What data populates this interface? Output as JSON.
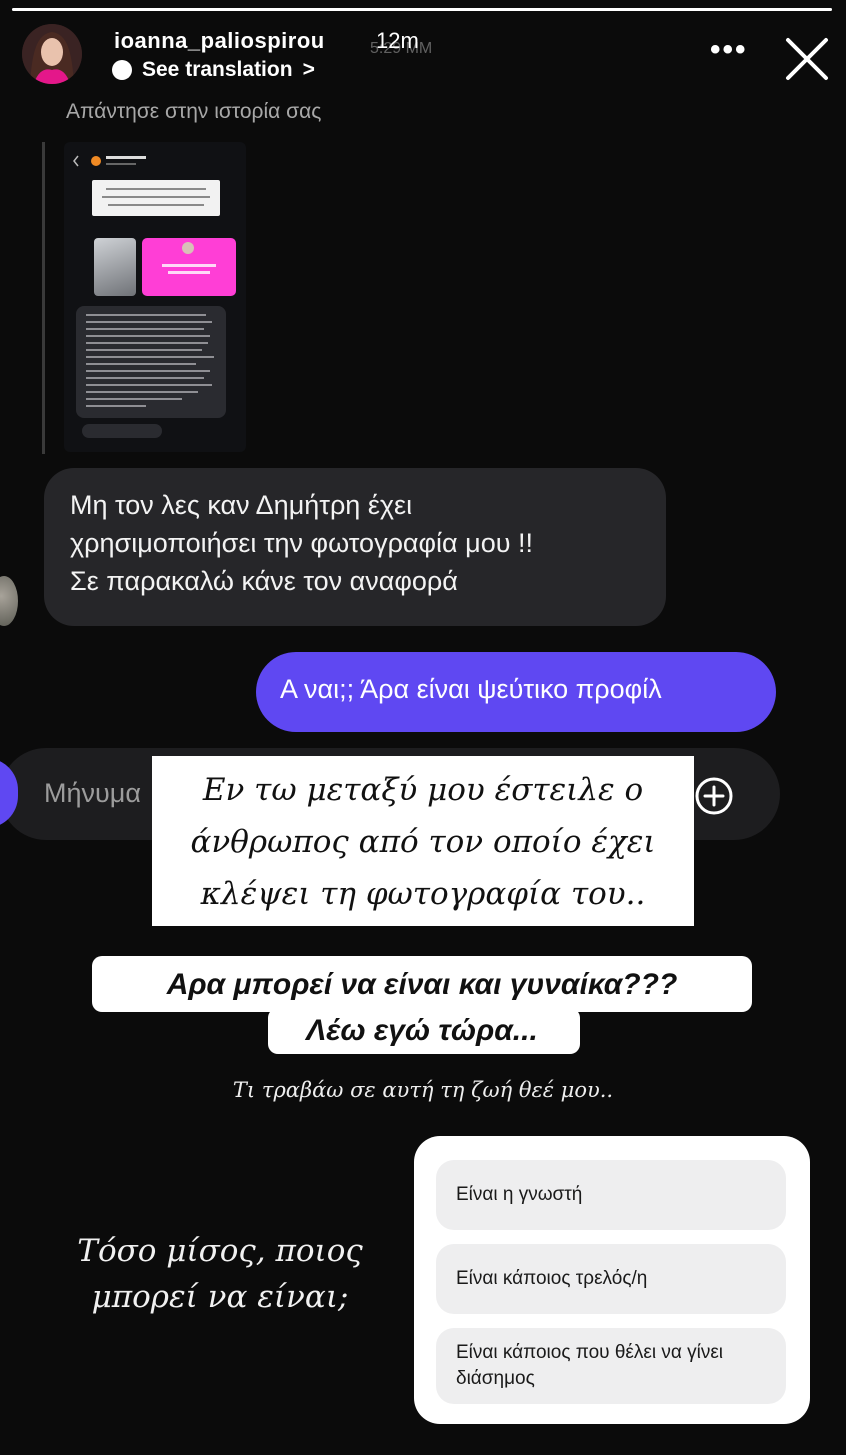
{
  "story": {
    "progress": 1.0,
    "username": "ioanna_paliospirou",
    "time_ago": "12m",
    "time_ghost": "5:29 MM",
    "see_translation": "See translation",
    "chevron": ">",
    "more": "•••",
    "reply_label": "Απάντησε στην ιστορία σας"
  },
  "chat": {
    "received_message_lines": [
      "Μη τον λες καν Δημήτρη έχει",
      "χρησιμοποιήσει την φωτογραφία μου !!",
      "Σε παρακαλώ κάνε τον αναφορά"
    ],
    "sent_message": "Α ναι;; Άρα είναι ψεύτικο προφίλ",
    "composer_placeholder": "Μήνυμα"
  },
  "stickers": {
    "white_text_lines": [
      "Εν τω μεταξύ μου έστειλε ο",
      "άνθρωπος από τον οποίο έχει",
      "κλέψει τη φωτογραφία του.."
    ],
    "bold_tag_lines": [
      "Αρα μπορεί να είναι και γυναίκα???",
      "Λέω εγώ τώρα..."
    ],
    "caption_small": "Τι τραβάω σε αυτή τη ζωή θεέ μου..",
    "caption_big_lines": [
      "Τόσο μίσος, ποιος",
      "μπορεί να είναι;"
    ]
  },
  "poll": {
    "options": [
      "Είναι η γνωστή",
      "Είναι κάποιος τρελός/η",
      "Είναι κάποιος που θέλει να γίνει διάσημος"
    ]
  },
  "colors": {
    "background": "#0b0b0b",
    "sent_bubble": "#5f48f2",
    "received_bubble": "#262629",
    "poll_option": "#eeeeef"
  },
  "icons": [
    "close-icon",
    "more-icon",
    "plus-icon",
    "camera-icon",
    "translate-icon"
  ]
}
